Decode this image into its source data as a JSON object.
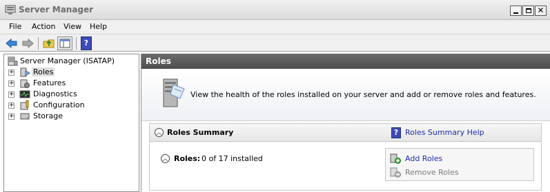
{
  "window": {
    "title": "Server Manager"
  },
  "menu": [
    "File",
    "Action",
    "View",
    "Help"
  ],
  "toolbar": {
    "icons": [
      "back-arrow-icon",
      "forward-arrow-icon",
      "up-folder-icon",
      "show-hide-tree-icon",
      "help-icon"
    ]
  },
  "tree": {
    "root": "Server Manager (ISATAP)",
    "items": [
      {
        "label": "Roles",
        "icon": "roles-icon",
        "selected": true
      },
      {
        "label": "Features",
        "icon": "features-icon"
      },
      {
        "label": "Diagnostics",
        "icon": "diagnostics-icon"
      },
      {
        "label": "Configuration",
        "icon": "configuration-icon"
      },
      {
        "label": "Storage",
        "icon": "storage-icon"
      }
    ]
  },
  "content": {
    "header": "Roles",
    "description": "View the health of the roles installed on your server and add or remove roles and features.",
    "summary": {
      "title": "Roles Summary",
      "help_link": "Roles Summary Help",
      "roles_label": "Roles:",
      "roles_value": "0 of 17 installed",
      "actions": {
        "add": "Add Roles",
        "remove": "Remove Roles"
      }
    }
  }
}
